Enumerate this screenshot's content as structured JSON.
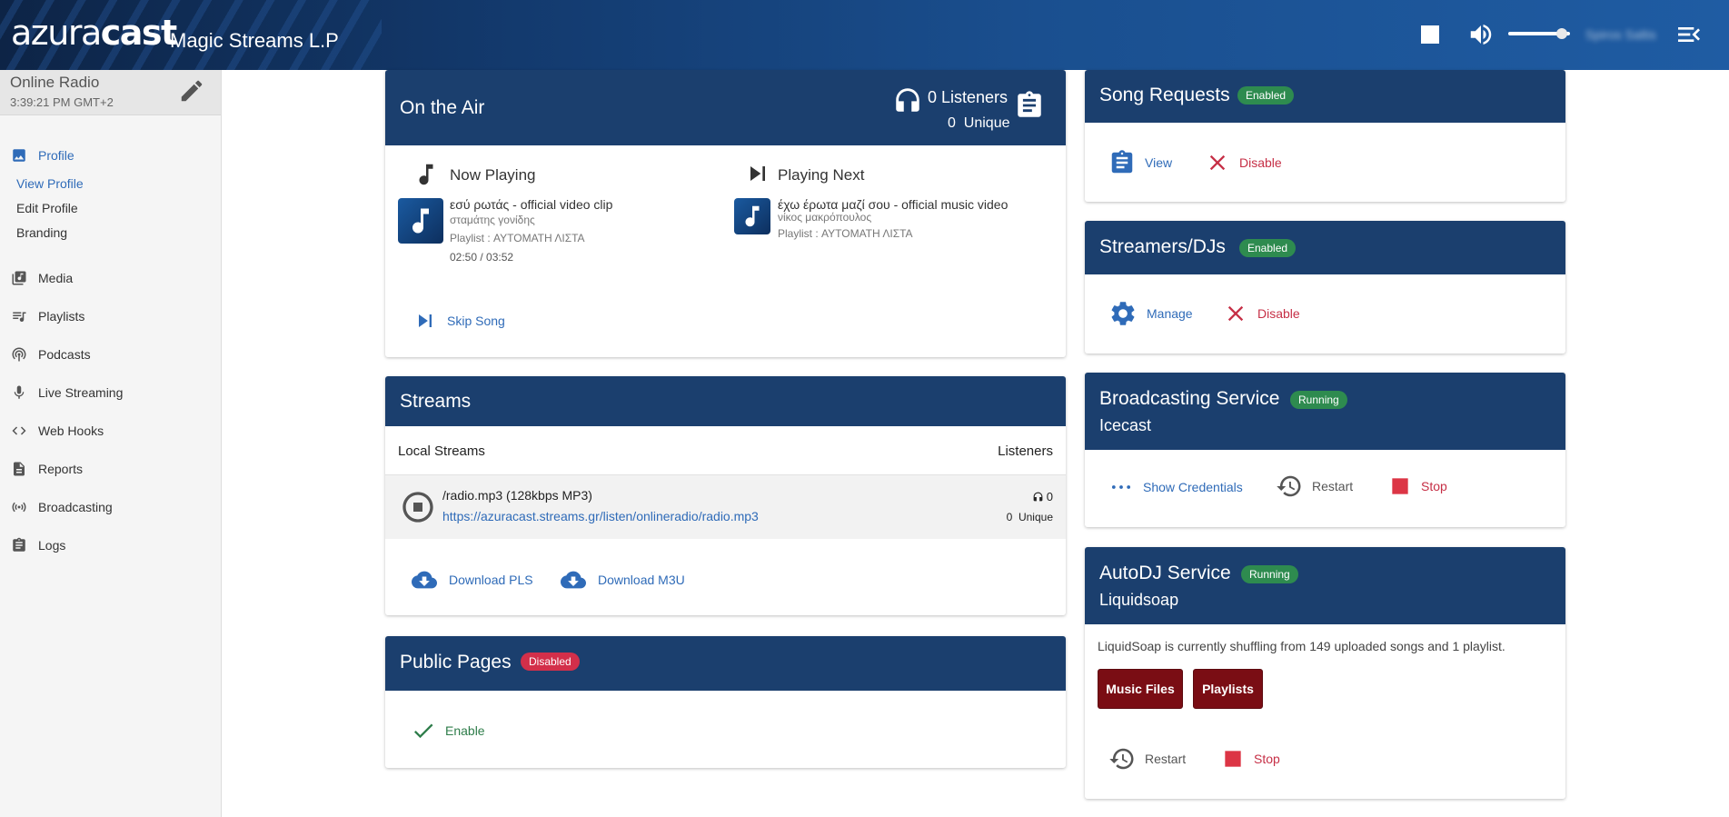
{
  "header": {
    "logo": "azuracast",
    "station_title": "Magic Streams L.P",
    "user_name": "Spiros Saltis"
  },
  "sidebar": {
    "station_name": "Online Radio",
    "time": "3:39:21 PM GMT+2",
    "profile_label": "Profile",
    "profile_sub": [
      "View Profile",
      "Edit Profile",
      "Branding"
    ],
    "items": [
      "Media",
      "Playlists",
      "Podcasts",
      "Live Streaming",
      "Web Hooks",
      "Reports",
      "Broadcasting",
      "Logs"
    ]
  },
  "on_air": {
    "title": "On the Air",
    "listeners": "0 Listeners",
    "unique_count": "0",
    "unique_label": "Unique",
    "now_playing_label": "Now Playing",
    "now_title": "εσύ ρωτάς - official video clip",
    "now_artist": "σταμάτης γονίδης",
    "now_playlist": "Playlist : ΑΥΤΟΜΑΤΗ ΛΙΣΤΑ",
    "now_time": "02:50 / 03:52",
    "next_label": "Playing Next",
    "next_title": "έχω έρωτα μαζί σου - official music video",
    "next_artist": "νίκος μακρόπουλος",
    "next_playlist": "Playlist : ΑΥΤΟΜΑΤΗ ΛΙΣΤΑ",
    "skip_label": "Skip Song"
  },
  "streams": {
    "title": "Streams",
    "col_local": "Local Streams",
    "col_listeners": "Listeners",
    "row_name": "/radio.mp3 (128kbps MP3)",
    "row_url": "https://azuracast.streams.gr/listen/onlineradio/radio.mp3",
    "row_count": "0",
    "row_unique": "0  Unique",
    "download_pls": "Download PLS",
    "download_m3u": "Download M3U"
  },
  "public_pages": {
    "title": "Public Pages",
    "badge": "Disabled",
    "enable_label": "Enable"
  },
  "song_requests": {
    "title": "Song Requests",
    "badge": "Enabled",
    "view_label": "View",
    "disable_label": "Disable"
  },
  "streamers": {
    "title": "Streamers/DJs",
    "badge": "Enabled",
    "manage_label": "Manage",
    "disable_label": "Disable"
  },
  "broadcasting": {
    "title": "Broadcasting Service",
    "badge": "Running",
    "subtitle": "Icecast",
    "credentials_label": "Show Credentials",
    "restart_label": "Restart",
    "stop_label": "Stop"
  },
  "autodj": {
    "title": "AutoDJ Service",
    "badge": "Running",
    "subtitle": "Liquidsoap",
    "description": "LiquidSoap is currently shuffling from 149 uploaded songs and 1 playlist.",
    "music_files_label": "Music Files",
    "playlists_label": "Playlists",
    "restart_label": "Restart",
    "stop_label": "Stop"
  },
  "colors": {
    "header_blue": "#1b3f6e",
    "link_blue": "#2f6bb8",
    "danger_red": "#c62f46",
    "success_green": "#2e8b4f",
    "dark_red_button": "#7a0d14"
  }
}
